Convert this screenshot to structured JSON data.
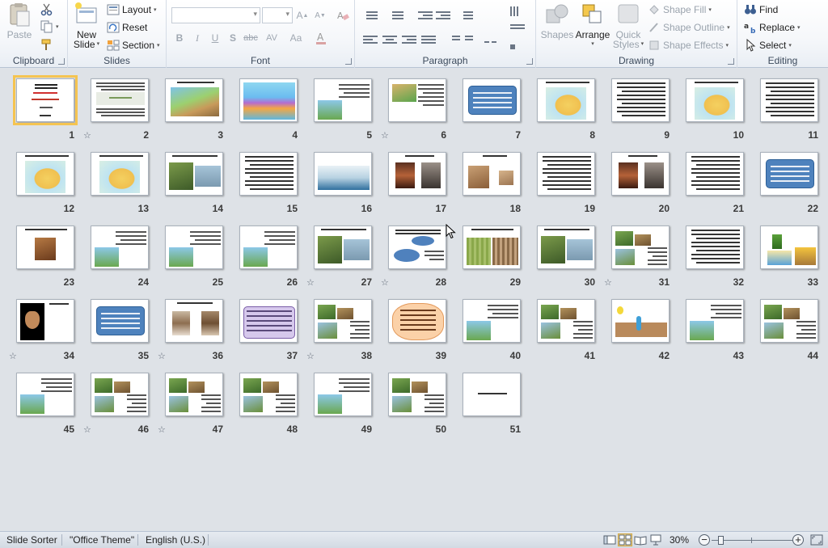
{
  "ribbon": {
    "clipboard": {
      "paste": "Paste",
      "label": "Clipboard"
    },
    "slides": {
      "new_slide_line1": "New",
      "new_slide_line2": "Slide",
      "layout": "Layout",
      "reset": "Reset",
      "section": "Section",
      "label": "Slides"
    },
    "font": {
      "label": "Font"
    },
    "paragraph": {
      "label": "Paragraph"
    },
    "drawing": {
      "shapes": "Shapes",
      "arrange": "Arrange",
      "quick_styles_line1": "Quick",
      "quick_styles_line2": "Styles",
      "shape_fill": "Shape Fill",
      "shape_outline": "Shape Outline",
      "shape_effects": "Shape Effects",
      "label": "Drawing"
    },
    "editing": {
      "find": "Find",
      "replace": "Replace",
      "select": "Select",
      "label": "Editing"
    }
  },
  "sorter": {
    "selected_slide": 1,
    "slides": [
      {
        "num": "1",
        "kind": "title",
        "star": false
      },
      {
        "num": "2",
        "kind": "textbox",
        "star": true
      },
      {
        "num": "3",
        "kind": "diagram",
        "star": false
      },
      {
        "num": "4",
        "kind": "diagram2",
        "star": false
      },
      {
        "num": "5",
        "kind": "textpic",
        "star": false
      },
      {
        "num": "6",
        "kind": "textpic2",
        "star": true
      },
      {
        "num": "7",
        "kind": "bluecard",
        "star": false
      },
      {
        "num": "8",
        "kind": "map",
        "star": false
      },
      {
        "num": "9",
        "kind": "text",
        "star": false
      },
      {
        "num": "10",
        "kind": "map",
        "star": false
      },
      {
        "num": "11",
        "kind": "text",
        "star": false
      },
      {
        "num": "12",
        "kind": "map",
        "star": false
      },
      {
        "num": "13",
        "kind": "map",
        "star": false
      },
      {
        "num": "14",
        "kind": "photos",
        "star": false
      },
      {
        "num": "15",
        "kind": "text",
        "star": false
      },
      {
        "num": "16",
        "kind": "ship",
        "star": false
      },
      {
        "num": "17",
        "kind": "cave",
        "star": false
      },
      {
        "num": "18",
        "kind": "photos2",
        "star": false
      },
      {
        "num": "19",
        "kind": "text",
        "star": false
      },
      {
        "num": "20",
        "kind": "cave",
        "star": false
      },
      {
        "num": "21",
        "kind": "text",
        "star": false
      },
      {
        "num": "22",
        "kind": "bluecard",
        "star": false
      },
      {
        "num": "23",
        "kind": "smallpic",
        "star": false
      },
      {
        "num": "24",
        "kind": "textpic",
        "star": false
      },
      {
        "num": "25",
        "kind": "textpic",
        "star": false
      },
      {
        "num": "26",
        "kind": "textpic",
        "star": false
      },
      {
        "num": "27",
        "kind": "photos",
        "star": true
      },
      {
        "num": "28",
        "kind": "ovals",
        "star": true
      },
      {
        "num": "29",
        "kind": "fields",
        "star": false
      },
      {
        "num": "30",
        "kind": "photos",
        "star": false
      },
      {
        "num": "31",
        "kind": "collage",
        "star": true
      },
      {
        "num": "32",
        "kind": "text",
        "star": false
      },
      {
        "num": "33",
        "kind": "plants",
        "star": false
      },
      {
        "num": "34",
        "kind": "hands",
        "star": true
      },
      {
        "num": "35",
        "kind": "bluecard",
        "star": false
      },
      {
        "num": "36",
        "kind": "soil",
        "star": true
      },
      {
        "num": "37",
        "kind": "purplecard",
        "star": false
      },
      {
        "num": "38",
        "kind": "collage",
        "star": true
      },
      {
        "num": "39",
        "kind": "cloud",
        "star": false
      },
      {
        "num": "40",
        "kind": "textpic",
        "star": false
      },
      {
        "num": "41",
        "kind": "collage",
        "star": false
      },
      {
        "num": "42",
        "kind": "plantdiag",
        "star": false
      },
      {
        "num": "43",
        "kind": "textpic",
        "star": false
      },
      {
        "num": "44",
        "kind": "collage",
        "star": false
      },
      {
        "num": "45",
        "kind": "textpic",
        "star": false
      },
      {
        "num": "46",
        "kind": "collage",
        "star": true
      },
      {
        "num": "47",
        "kind": "collage",
        "star": true
      },
      {
        "num": "48",
        "kind": "collage",
        "star": false
      },
      {
        "num": "49",
        "kind": "textpic",
        "star": false
      },
      {
        "num": "50",
        "kind": "collage",
        "star": false
      },
      {
        "num": "51",
        "kind": "line",
        "star": false
      }
    ]
  },
  "status": {
    "view": "Slide Sorter",
    "theme": "\"Office Theme\"",
    "language": "English (U.S.)",
    "zoom": "30%",
    "zoom_level": 0.3
  }
}
